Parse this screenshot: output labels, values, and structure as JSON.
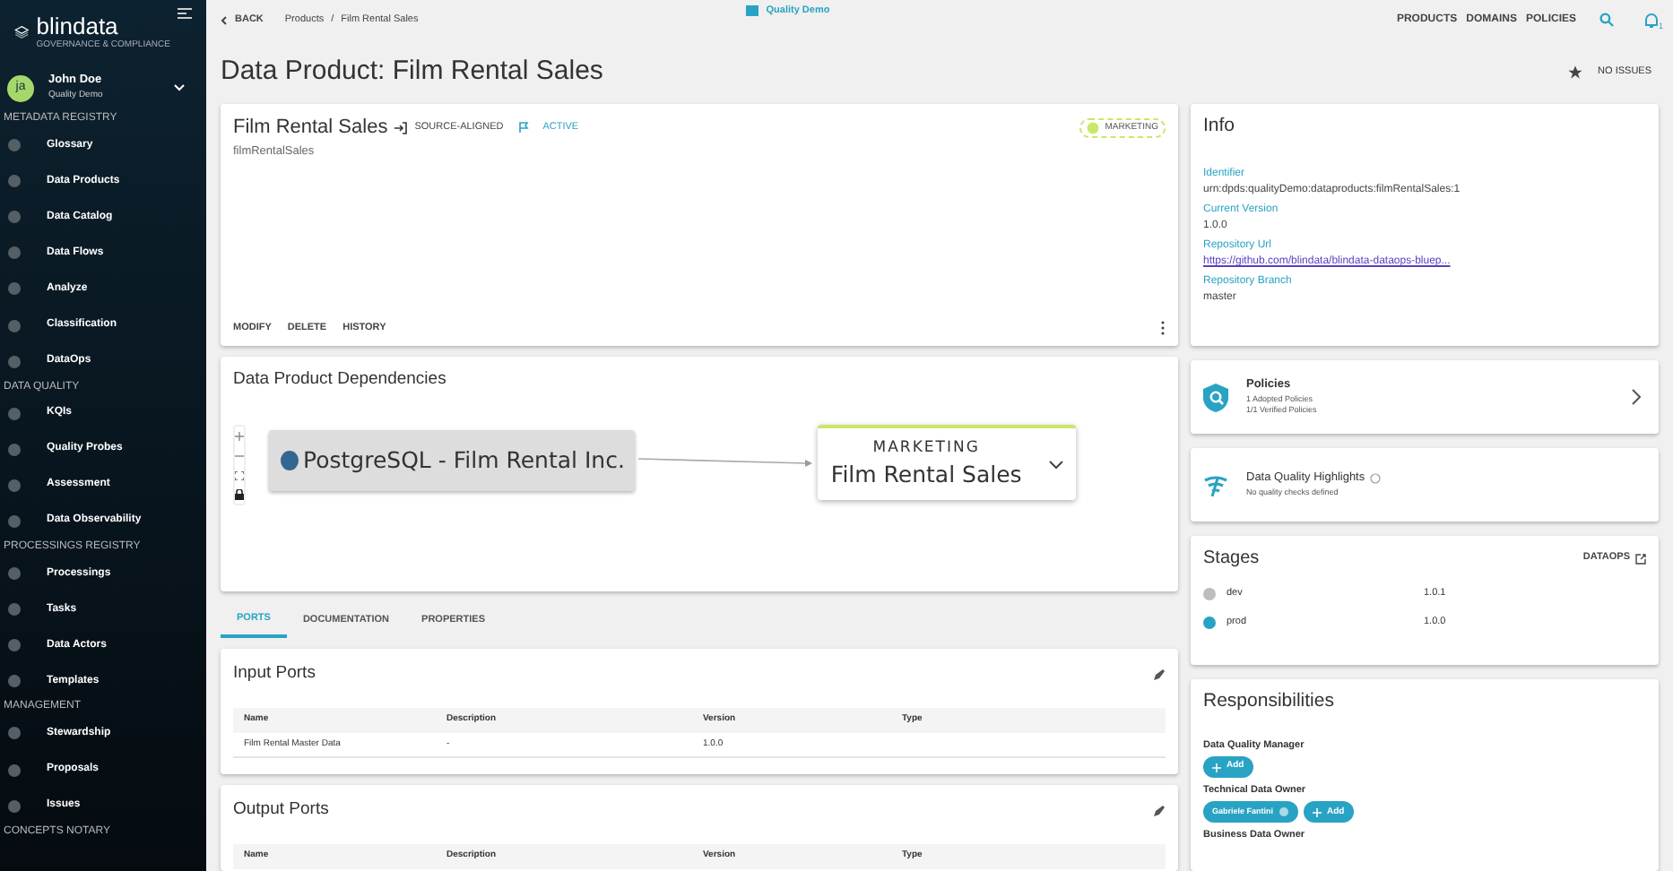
{
  "sidebar": {
    "logo": "blindata",
    "tagline": "GOVERNANCE & COMPLIANCE",
    "user": {
      "initials": "ja",
      "name": "John Doe",
      "tenant": "Quality Demo"
    },
    "sections": [
      {
        "title": "METADATA REGISTRY",
        "items": [
          "Glossary",
          "Data Products",
          "Data Catalog",
          "Data Flows",
          "Analyze",
          "Classification",
          "DataOps"
        ]
      },
      {
        "title": "DATA QUALITY",
        "items": [
          "KQIs",
          "Quality Probes",
          "Assessment",
          "Data Observability"
        ]
      },
      {
        "title": "PROCESSINGS REGISTRY",
        "items": [
          "Processings",
          "Tasks",
          "Data Actors",
          "Templates"
        ]
      },
      {
        "title": "MANAGEMENT",
        "items": [
          "Stewardship",
          "Proposals",
          "Issues"
        ]
      },
      {
        "title": "CONCEPTS NOTARY"
      }
    ]
  },
  "topbar": {
    "back": "BACK",
    "breadcrumbs": [
      "Products",
      "Film Rental Sales"
    ],
    "breadcrumb_separator": "/",
    "tenant": "Quality Demo",
    "nav": [
      "PRODUCTS",
      "DOMAINS",
      "POLICIES"
    ],
    "notifications": "1"
  },
  "page": {
    "title": "Data Product: Film Rental Sales",
    "issues": "NO ISSUES"
  },
  "product": {
    "name": "Film Rental Sales",
    "type": "SOURCE-ALIGNED",
    "status": "ACTIVE",
    "identifier": "filmRentalSales",
    "domain": "MARKETING",
    "actions": [
      "MODIFY",
      "DELETE",
      "HISTORY"
    ]
  },
  "dependencies": {
    "title": "Data Product Dependencies",
    "source": "PostgreSQL - Film Rental Inc.",
    "target": {
      "domain": "MARKETING",
      "name": "Film Rental Sales"
    }
  },
  "tabs": [
    {
      "label": "PORTS",
      "selected": true
    },
    {
      "label": "DOCUMENTATION",
      "selected": false
    },
    {
      "label": "PROPERTIES",
      "selected": false
    }
  ],
  "input_ports": {
    "title": "Input Ports",
    "columns": [
      "Name",
      "Description",
      "Version",
      "Type"
    ],
    "rows": [
      [
        "Film Rental Master Data",
        "-",
        "1.0.0",
        ""
      ]
    ]
  },
  "output_ports": {
    "title": "Output Ports",
    "columns": [
      "Name",
      "Description",
      "Version",
      "Type"
    ]
  },
  "info": {
    "title": "Info",
    "fields": [
      {
        "label": "Identifier",
        "value": "urn:dpds:qualityDemo:dataproducts:filmRentalSales:1",
        "kind": "text"
      },
      {
        "label": "Current Version",
        "value": "1.0.0",
        "kind": "text"
      },
      {
        "label": "Repository Url",
        "value": "https://github.com/blindata/blindata-dataops-bluep...",
        "kind": "link"
      },
      {
        "label": "Repository Branch",
        "value": "master",
        "kind": "text"
      }
    ]
  },
  "policies": {
    "title": "Policies",
    "lines": [
      "1 Adopted Policies",
      "1/1 Verified Policies"
    ]
  },
  "quality": {
    "title": "Data Quality Highlights",
    "subtitle": "No quality checks defined"
  },
  "stages": {
    "title": "Stages",
    "action": "DATAOPS",
    "items": [
      {
        "name": "dev",
        "version": "1.0.1",
        "color": "#bdbdbd"
      },
      {
        "name": "prod",
        "version": "1.0.0",
        "color": "#29a3c4"
      }
    ]
  },
  "responsibilities": {
    "title": "Responsibilities",
    "roles": [
      {
        "name": "Data Quality Manager",
        "add": "Add"
      },
      {
        "name": "Technical Data Owner",
        "people": [
          "Gabriele Fantini"
        ],
        "add": "Add"
      },
      {
        "name": "Business Data Owner"
      }
    ]
  }
}
